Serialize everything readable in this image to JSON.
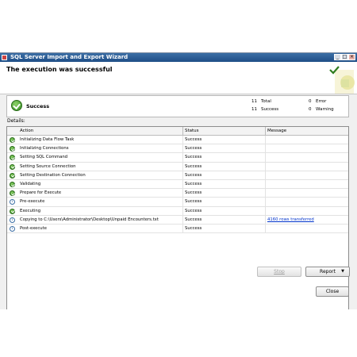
{
  "window": {
    "title": "SQL Server Import and Export Wizard",
    "minimize": "_",
    "maximize": "□",
    "close": "×"
  },
  "header": {
    "heading": "The execution was successful"
  },
  "summary": {
    "status": "Success",
    "total_count": "11",
    "total_label": "Total",
    "success_count": "11",
    "success_label": "Success",
    "error_count": "0",
    "error_label": "Error",
    "warning_count": "0",
    "warning_label": "Warning"
  },
  "details": {
    "label": "Details:",
    "columns": {
      "action": "Action",
      "status": "Status",
      "message": "Message"
    },
    "rows": [
      {
        "icon": "success",
        "action": "Initializing Data Flow Task",
        "status": "Success",
        "message": ""
      },
      {
        "icon": "success",
        "action": "Initializing Connections",
        "status": "Success",
        "message": ""
      },
      {
        "icon": "success",
        "action": "Setting SQL Command",
        "status": "Success",
        "message": ""
      },
      {
        "icon": "success",
        "action": "Setting Source Connection",
        "status": "Success",
        "message": ""
      },
      {
        "icon": "success",
        "action": "Setting Destination Connection",
        "status": "Success",
        "message": ""
      },
      {
        "icon": "success",
        "action": "Validating",
        "status": "Success",
        "message": ""
      },
      {
        "icon": "success",
        "action": "Prepare for Execute",
        "status": "Success",
        "message": ""
      },
      {
        "icon": "info",
        "action": "Pre-execute",
        "status": "Success",
        "message": ""
      },
      {
        "icon": "success",
        "action": "Executing",
        "status": "Success",
        "message": ""
      },
      {
        "icon": "info",
        "action": "Copying to C:\\Users\\Administrator\\Desktop\\Unpaid Encounters.txt",
        "status": "Success",
        "message": "4160 rows transferred"
      },
      {
        "icon": "info",
        "action": "Post-execute",
        "status": "Success",
        "message": ""
      }
    ]
  },
  "buttons": {
    "stop": "Stop",
    "report": "Report",
    "close": "Close"
  },
  "icons": {
    "header_logo": "wizard-logo-icon",
    "summary": "success-check-icon"
  }
}
